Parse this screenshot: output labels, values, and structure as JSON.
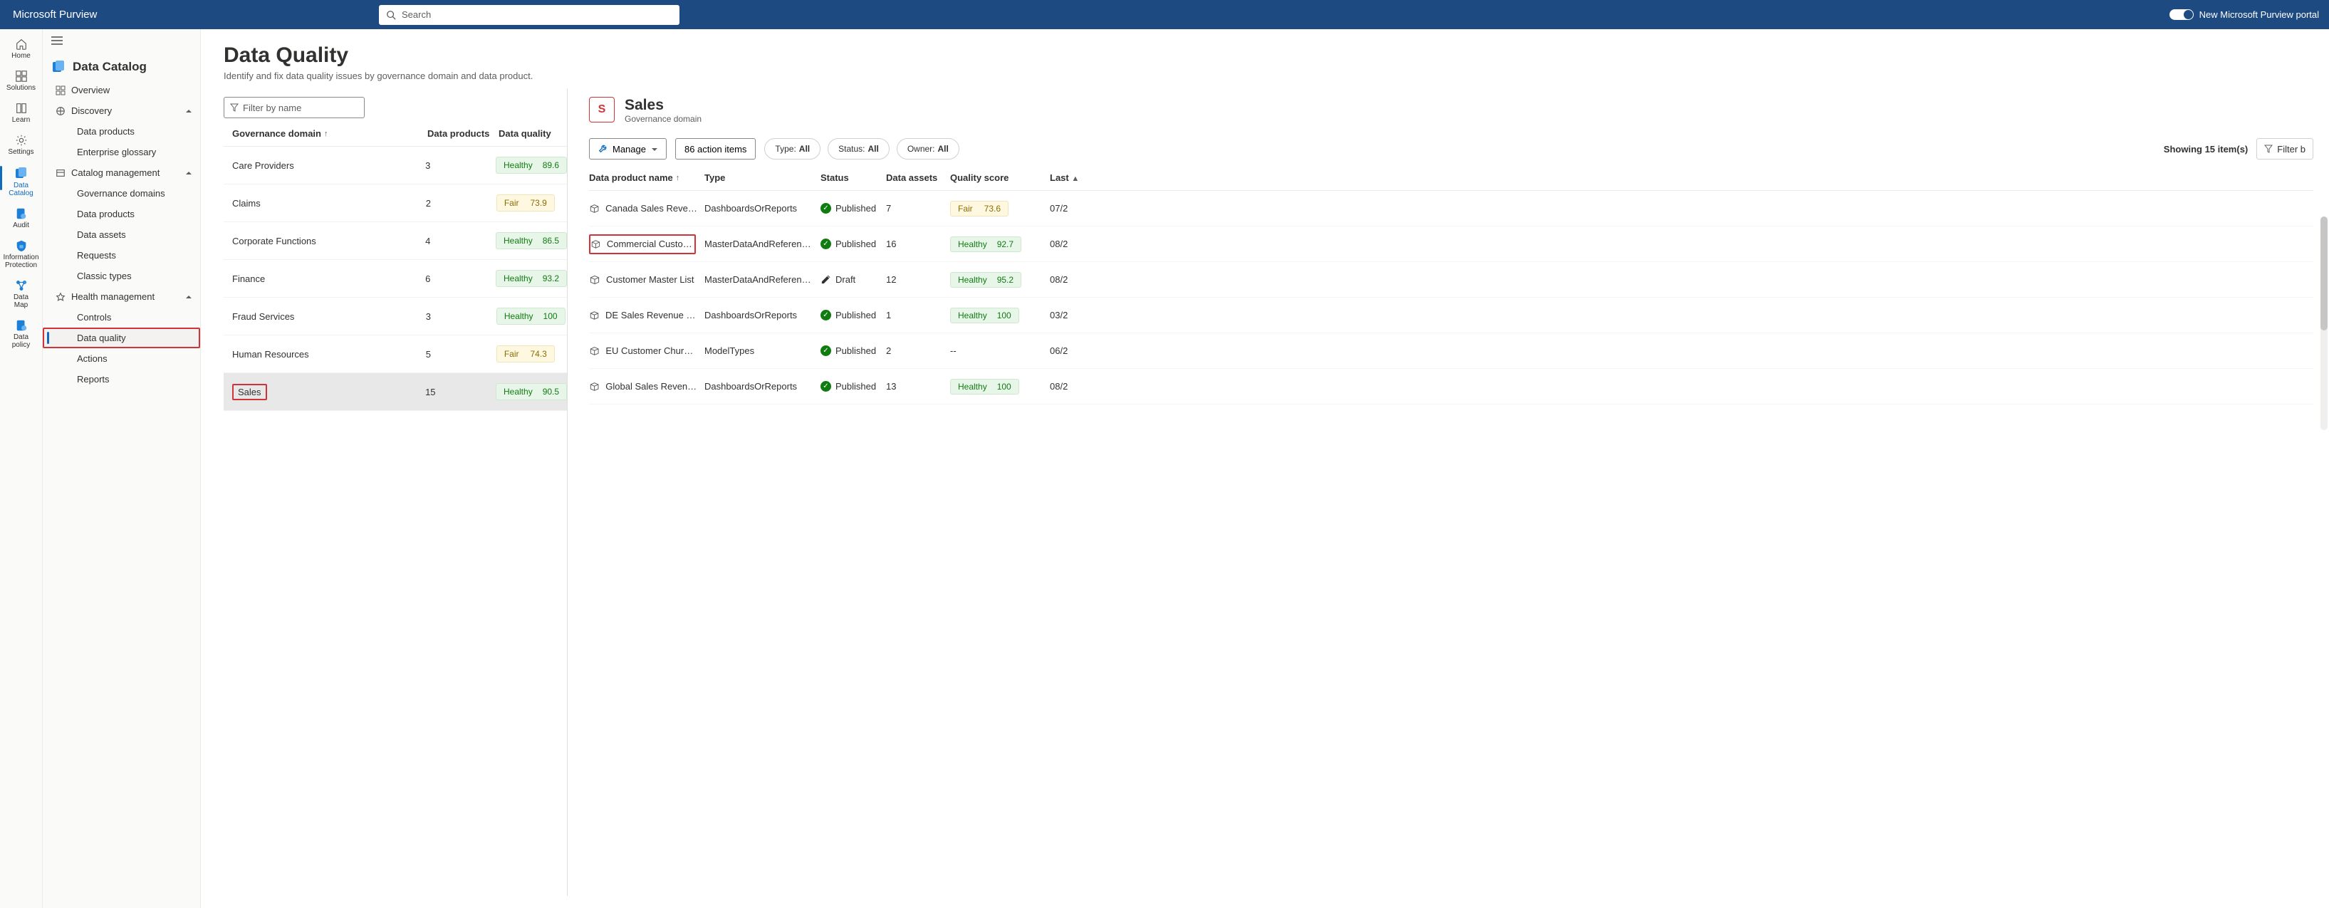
{
  "brand": "Microsoft Purview",
  "search_placeholder": "Search",
  "portal_toggle_label": "New Microsoft Purview portal",
  "rail": [
    {
      "label": "Home"
    },
    {
      "label": "Solutions"
    },
    {
      "label": "Learn"
    },
    {
      "label": "Settings"
    },
    {
      "label": "Data Catalog",
      "active": true
    },
    {
      "label": "Audit"
    },
    {
      "label": "Information Protection",
      "multiline": true
    },
    {
      "label": "Data Map"
    },
    {
      "label": "Data policy"
    }
  ],
  "sidebar": {
    "title": "Data Catalog",
    "overview": "Overview",
    "groups": [
      {
        "label": "Discovery",
        "open": true,
        "items": [
          "Data products",
          "Enterprise glossary"
        ]
      },
      {
        "label": "Catalog management",
        "open": true,
        "items": [
          "Governance domains",
          "Data products",
          "Data assets",
          "Requests",
          "Classic types"
        ]
      },
      {
        "label": "Health management",
        "open": true,
        "items": [
          "Controls",
          "Data quality",
          "Actions",
          "Reports"
        ],
        "highlight_index": 1
      }
    ]
  },
  "page": {
    "title": "Data Quality",
    "subtitle": "Identify and fix data quality issues by governance domain and data product."
  },
  "filter_placeholder": "Filter by name",
  "grid": {
    "headers": {
      "c1": "Governance domain",
      "c2": "Data products",
      "c3": "Data quality"
    },
    "rows": [
      {
        "name": "Care Providers",
        "count": "3",
        "quality": "Healthy",
        "score": "89.6"
      },
      {
        "name": "Claims",
        "count": "2",
        "quality": "Fair",
        "score": "73.9"
      },
      {
        "name": "Corporate Functions",
        "count": "4",
        "quality": "Healthy",
        "score": "86.5"
      },
      {
        "name": "Finance",
        "count": "6",
        "quality": "Healthy",
        "score": "93.2"
      },
      {
        "name": "Fraud Services",
        "count": "3",
        "quality": "Healthy",
        "score": "100"
      },
      {
        "name": "Human Resources",
        "count": "5",
        "quality": "Fair",
        "score": "74.3"
      },
      {
        "name": "Sales",
        "count": "15",
        "quality": "Healthy",
        "score": "90.5",
        "selected": true,
        "red": true
      }
    ]
  },
  "detail": {
    "initial": "S",
    "title": "Sales",
    "subtitle": "Governance domain",
    "manage": "Manage",
    "actions": "86 action items",
    "chips": [
      {
        "label": "Type:",
        "value": "All"
      },
      {
        "label": "Status:",
        "value": "All"
      },
      {
        "label": "Owner:",
        "value": "All"
      }
    ],
    "showing": "Showing 15 item(s)",
    "filter": "Filter b",
    "headers": {
      "c1": "Data product name",
      "c2": "Type",
      "c3": "Status",
      "c4": "Data assets",
      "c5": "Quality score",
      "c6": "Last"
    },
    "rows": [
      {
        "name": "Canada Sales Reven…",
        "type": "DashboardsOrReports",
        "status": "Published",
        "assets": "7",
        "quality": "Fair",
        "score": "73.6",
        "last": "07/2"
      },
      {
        "name": "Commercial Custom…",
        "type": "MasterDataAndReferen…",
        "status": "Published",
        "assets": "16",
        "quality": "Healthy",
        "score": "92.7",
        "last": "08/2",
        "red": true
      },
      {
        "name": "Customer Master List",
        "type": "MasterDataAndReferen…",
        "status": "Draft",
        "assets": "12",
        "quality": "Healthy",
        "score": "95.2",
        "last": "08/2",
        "draft": true
      },
      {
        "name": "DE Sales Revenue In…",
        "type": "DashboardsOrReports",
        "status": "Published",
        "assets": "1",
        "quality": "Healthy",
        "score": "100",
        "last": "03/2"
      },
      {
        "name": "EU Customer Churn …",
        "type": "ModelTypes",
        "status": "Published",
        "assets": "2",
        "quality": "",
        "score": "--",
        "last": "06/2"
      },
      {
        "name": "Global Sales Revenu…",
        "type": "DashboardsOrReports",
        "status": "Published",
        "assets": "13",
        "quality": "Healthy",
        "score": "100",
        "last": "08/2"
      }
    ]
  }
}
